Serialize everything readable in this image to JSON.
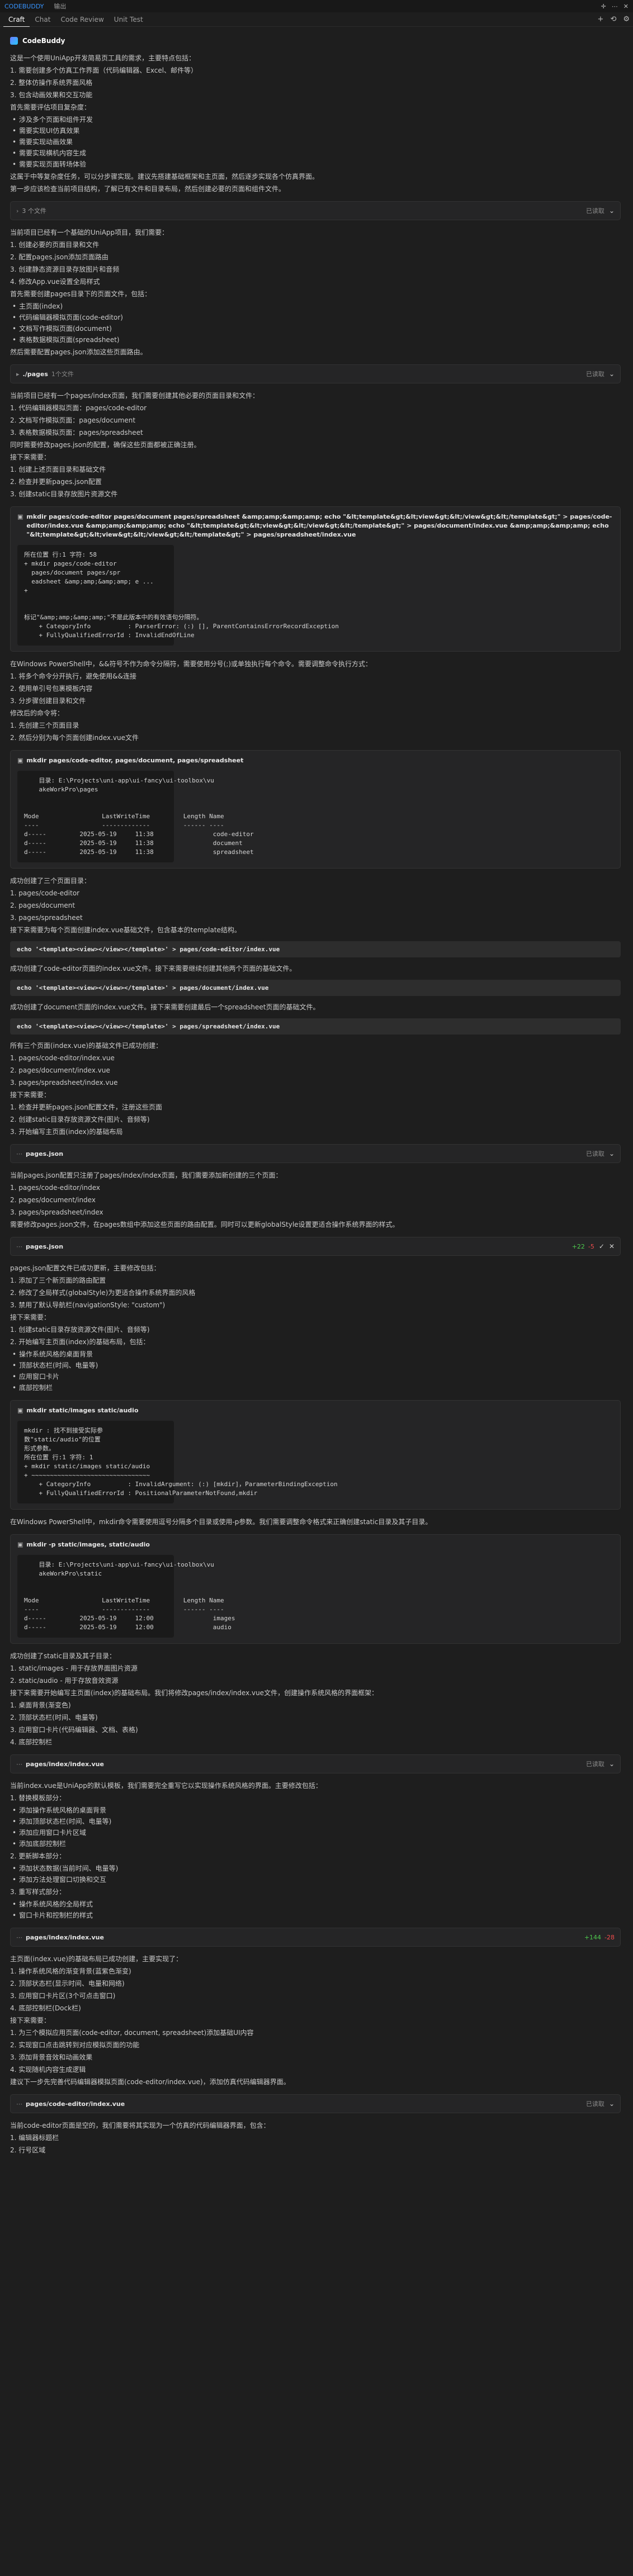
{
  "window": {
    "app_name": "CODEBUDDY",
    "panel_label": "输出"
  },
  "tabs": [
    "Craft",
    "Chat",
    "Code Review",
    "Unit Test"
  ],
  "brand": "CodeBuddy",
  "intro": {
    "lines": [
      "这是一个使用UniApp开发简易页工具的需求，主要特点包括：",
      "1. 需要创建多个仿真工作界面（代码编辑器、Excel、邮件等）",
      "2. 整体仿操作系统界面风格",
      "3. 包含动画效果和交互功能",
      "首先需要评估项目复杂度："
    ],
    "bullets": [
      "涉及多个页面和组件开发",
      "需要实现UI仿真效果",
      "需要实现动画效果",
      "需要实现横机内容生成",
      "需要实现页面转场体验"
    ],
    "tail": [
      "这属于中等复杂度任务，可以分步骤实现。建议先搭建基础框架和主页面，然后逐步实现各个仿真界面。",
      "第一步应该检查当前项目结构，了解已有文件和目录布局，然后创建必要的页面和组件文件。"
    ]
  },
  "b1": {
    "name": "3 个文件",
    "status": "已读取"
  },
  "s2": {
    "lines": [
      "当前项目已经有一个基础的UniApp项目，我们需要：",
      "1. 创建必要的页面目录和文件",
      "2. 配置pages.json添加页面路由",
      "3. 创建静态资源目录存放图片和音频",
      "4. 修改App.vue设置全局样式",
      "首先需要创建pages目录下的页面文件，包括："
    ],
    "bullets": [
      "主页面(index)",
      "代码编辑器模拟页面(code-editor)",
      "文档写作模拟页面(document)",
      "表格数据模拟页面(spreadsheet)"
    ],
    "tail": "然后需要配置pages.json添加这些页面路由。"
  },
  "b2": {
    "name": "./pages",
    "meta": "1个文件",
    "status": "已读取"
  },
  "s3": {
    "lines": [
      "当前项目已经有一个pages/index页面，我们需要创建其他必要的页面目录和文件：",
      "1. 代码编辑器模拟页面：pages/code-editor",
      "2. 文档写作模拟页面：pages/document",
      "3. 表格数据模拟页面：pages/spreadsheet",
      "同时需要修改pages.json的配置，确保这些页面都被正确注册。",
      "接下来需要：",
      "1. 创建上述页面目录和基础文件",
      "2. 检查并更新pages.json配置",
      "3. 创建static目录存放图片资源文件"
    ]
  },
  "c1": {
    "command": "mkdir pages/code-editor pages/document pages/spreadsheet &amp;amp;&amp;amp; echo \"&lt;template&gt;&lt;view&gt;&lt;/view&gt;&lt;/template&gt;\" > pages/code-editor/index.vue &amp;amp;&amp;amp; echo \"&lt;template&gt;&lt;view&gt;&lt;/view&gt;&lt;/template&gt;\" > pages/document/index.vue &amp;amp;&amp;amp; echo \"&lt;template&gt;&lt;view&gt;&lt;/view&gt;&lt;/template&gt;\" > pages/spreadsheet/index.vue",
    "output": "所在位置 行:1 字符: 58\n+ mkdir pages/code-editor\n  pages/document pages/spr\n  eadsheet &amp;amp;&amp;amp; e ...\n+\n\n\n标记\"&amp;amp;&amp;amp;\"不是此版本中的有效语句分隔符。\n    + CategoryInfo          : ParserError: (:) [], ParentContainsErrorRecordException\n    + FullyQualifiedErrorId : InvalidEndOfLine"
  },
  "s4": {
    "lines": [
      "在Windows PowerShell中，&&符号不作为命令分隔符，需要使用分号(;)或单独执行每个命令。需要调整命令执行方式：",
      "1. 将多个命令分开执行，避免使用&&连接",
      "2. 使用单引号包裹模板内容",
      "3. 分步骤创建目录和文件",
      "修改后的命令将：",
      "1. 先创建三个页面目录",
      "2. 然后分别为每个页面创建index.vue文件"
    ]
  },
  "c2": {
    "command": "mkdir pages/code-editor, pages/document, pages/spreadsheet",
    "output": "    目录: E:\\Projects\\uni-app\\ui-fancy\\ui-toolbox\\vu\n    akeWorkPro\\pages\n\n\nMode                 LastWriteTime         Length Name\n----                 -------------         ------ ----\nd-----         2025-05-19     11:38                code-editor\nd-----         2025-05-19     11:38                document\nd-----         2025-05-19     11:38                spreadsheet"
  },
  "s5": {
    "lines": [
      "成功创建了三个页面目录：",
      "1. pages/code-editor",
      "2. pages/document",
      "3. pages/spreadsheet",
      "接下来需要为每个页面创建index.vue基础文件，包含基本的template结构。"
    ]
  },
  "e1": "echo '<template><view></view></template>' > pages/code-editor/index.vue",
  "s6": "成功创建了code-editor页面的index.vue文件。接下来需要继续创建其他两个页面的基础文件。",
  "e2": "echo '<template><view></view></template>' > pages/document/index.vue",
  "s7": "成功创建了document页面的index.vue文件。接下来需要创建最后一个spreadsheet页面的基础文件。",
  "e3": "echo '<template><view></view></template>' > pages/spreadsheet/index.vue",
  "s8": {
    "lines": [
      "所有三个页面(index.vue)的基础文件已成功创建：",
      "1. pages/code-editor/index.vue",
      "2. pages/document/index.vue",
      "3. pages/spreadsheet/index.vue",
      "接下来需要：",
      "1. 检查并更新pages.json配置文件，注册这些页面",
      "2. 创建static目录存放资源文件(图片、音频等)",
      "3. 开始编写主页面(index)的基础布局"
    ]
  },
  "b3": {
    "name": "pages.json",
    "status": "已读取"
  },
  "s9": {
    "lines": [
      "当前pages.json配置只注册了pages/index/index页面，我们需要添加新创建的三个页面：",
      "1. pages/code-editor/index",
      "2. pages/document/index",
      "3. pages/spreadsheet/index",
      "需要修改pages.json文件，在pages数组中添加这些页面的路由配置。同时可以更新globalStyle设置更适合操作系统界面的样式。"
    ]
  },
  "b4": {
    "name": "pages.json",
    "add": "+22",
    "del": "-5",
    "status": ""
  },
  "s10": {
    "lines": [
      "pages.json配置文件已成功更新，主要修改包括：",
      "1. 添加了三个新页面的路由配置",
      "2. 修改了全局样式(globalStyle)为更适合操作系统界面的风格",
      "3. 禁用了默认导航栏(navigationStyle: \"custom\")",
      "接下来需要：",
      "1. 创建static目录存放资源文件(图片、音频等)",
      "2. 开始编写主页面(index)的基础布局，包括："
    ],
    "bullets": [
      "操作系统风格的桌面背景",
      "顶部状态栏(时间、电量等)",
      "应用窗口卡片",
      "底部控制栏"
    ]
  },
  "c3": {
    "command": "mkdir static/images static/audio",
    "output": "mkdir : 找不到接受实际参\n数\"static/audio\"的位置\n形式参数。\n所在位置 行:1 字符: 1\n+ mkdir static/images static/audio\n+ ~~~~~~~~~~~~~~~~~~~~~~~~~~~~~~~~\n    + CategoryInfo          : InvalidArgument: (:) [mkdir]，ParameterBindingException\n    + FullyQualifiedErrorId : PositionalParameterNotFound,mkdir"
  },
  "s11": "在Windows PowerShell中，mkdir命令需要使用逗号分隔多个目录或使用-p参数。我们需要调整命令格式来正确创建static目录及其子目录。",
  "c4": {
    "command": "mkdir -p static/images, static/audio",
    "output": "    目录: E:\\Projects\\uni-app\\ui-fancy\\ui-toolbox\\vu\n    akeWorkPro\\static\n\n\nMode                 LastWriteTime         Length Name\n----                 -------------         ------ ----\nd-----         2025-05-19     12:00                images\nd-----         2025-05-19     12:00                audio"
  },
  "s12": {
    "lines": [
      "成功创建了static目录及其子目录：",
      "1. static/images - 用于存放界面图片资源",
      "2. static/audio - 用于存放音效资源",
      "接下来需要开始编写主页面(index)的基础布局。我们将修改pages/index/index.vue文件，创建操作系统风格的界面框架：",
      "1. 桌面背景(渐变色)",
      "2. 顶部状态栏(时间、电量等)",
      "3. 应用窗口卡片(代码编辑器、文档、表格)",
      "4. 底部控制栏"
    ]
  },
  "b5": {
    "name": "pages/index/index.vue",
    "status": "已读取"
  },
  "s13": {
    "lines": [
      "当前index.vue是UniApp的默认模板，我们需要完全重写它以实现操作系统风格的界面。主要修改包括：",
      "1. 替换模板部分："
    ],
    "bullets": [
      "添加操作系统风格的桌面背景",
      "添加顶部状态栏(时间、电量等)",
      "添加应用窗口卡片区域",
      "添加底部控制栏"
    ],
    "lines2": [
      "2. 更新脚本部分："
    ],
    "bullets2": [
      "添加状态数据(当前时间、电量等)",
      "添加方法处理窗口切换和交互"
    ],
    "lines3": [
      "3. 重写样式部分："
    ],
    "bullets3": [
      "操作系统风格的全局样式",
      "窗口卡片和控制栏的样式"
    ]
  },
  "b6": {
    "name": "pages/index/index.vue",
    "add": "+144",
    "del": "-28",
    "status": ""
  },
  "s14": {
    "lines": [
      "主页面(index.vue)的基础布局已成功创建，主要实现了：",
      "1. 操作系统风格的渐变背景(蓝紫色渐变)",
      "2. 顶部状态栏(显示时间、电量和网络)",
      "3. 应用窗口卡片区(3个可点击窗口)",
      "4. 底部控制栏(Dock栏)",
      "接下来需要：",
      "1. 为三个模拟应用页面(code-editor, document, spreadsheet)添加基础UI内容",
      "2. 实现窗口点击跳转到对应模拟页面的功能",
      "3. 添加背景音效和动画效果",
      "4. 实现随机内容生成逻辑",
      "建议下一步先完善代码编辑器模拟页面(code-editor/index.vue)，添加仿真代码编辑器界面。"
    ]
  },
  "b7": {
    "name": "pages/code-editor/index.vue",
    "status": "已读取"
  },
  "s15": {
    "lines": [
      "当前code-editor页面是空的，我们需要将其实现为一个仿真的代码编辑器界面，包含：",
      "1. 编辑器标题栏",
      "2. 行号区域"
    ]
  }
}
